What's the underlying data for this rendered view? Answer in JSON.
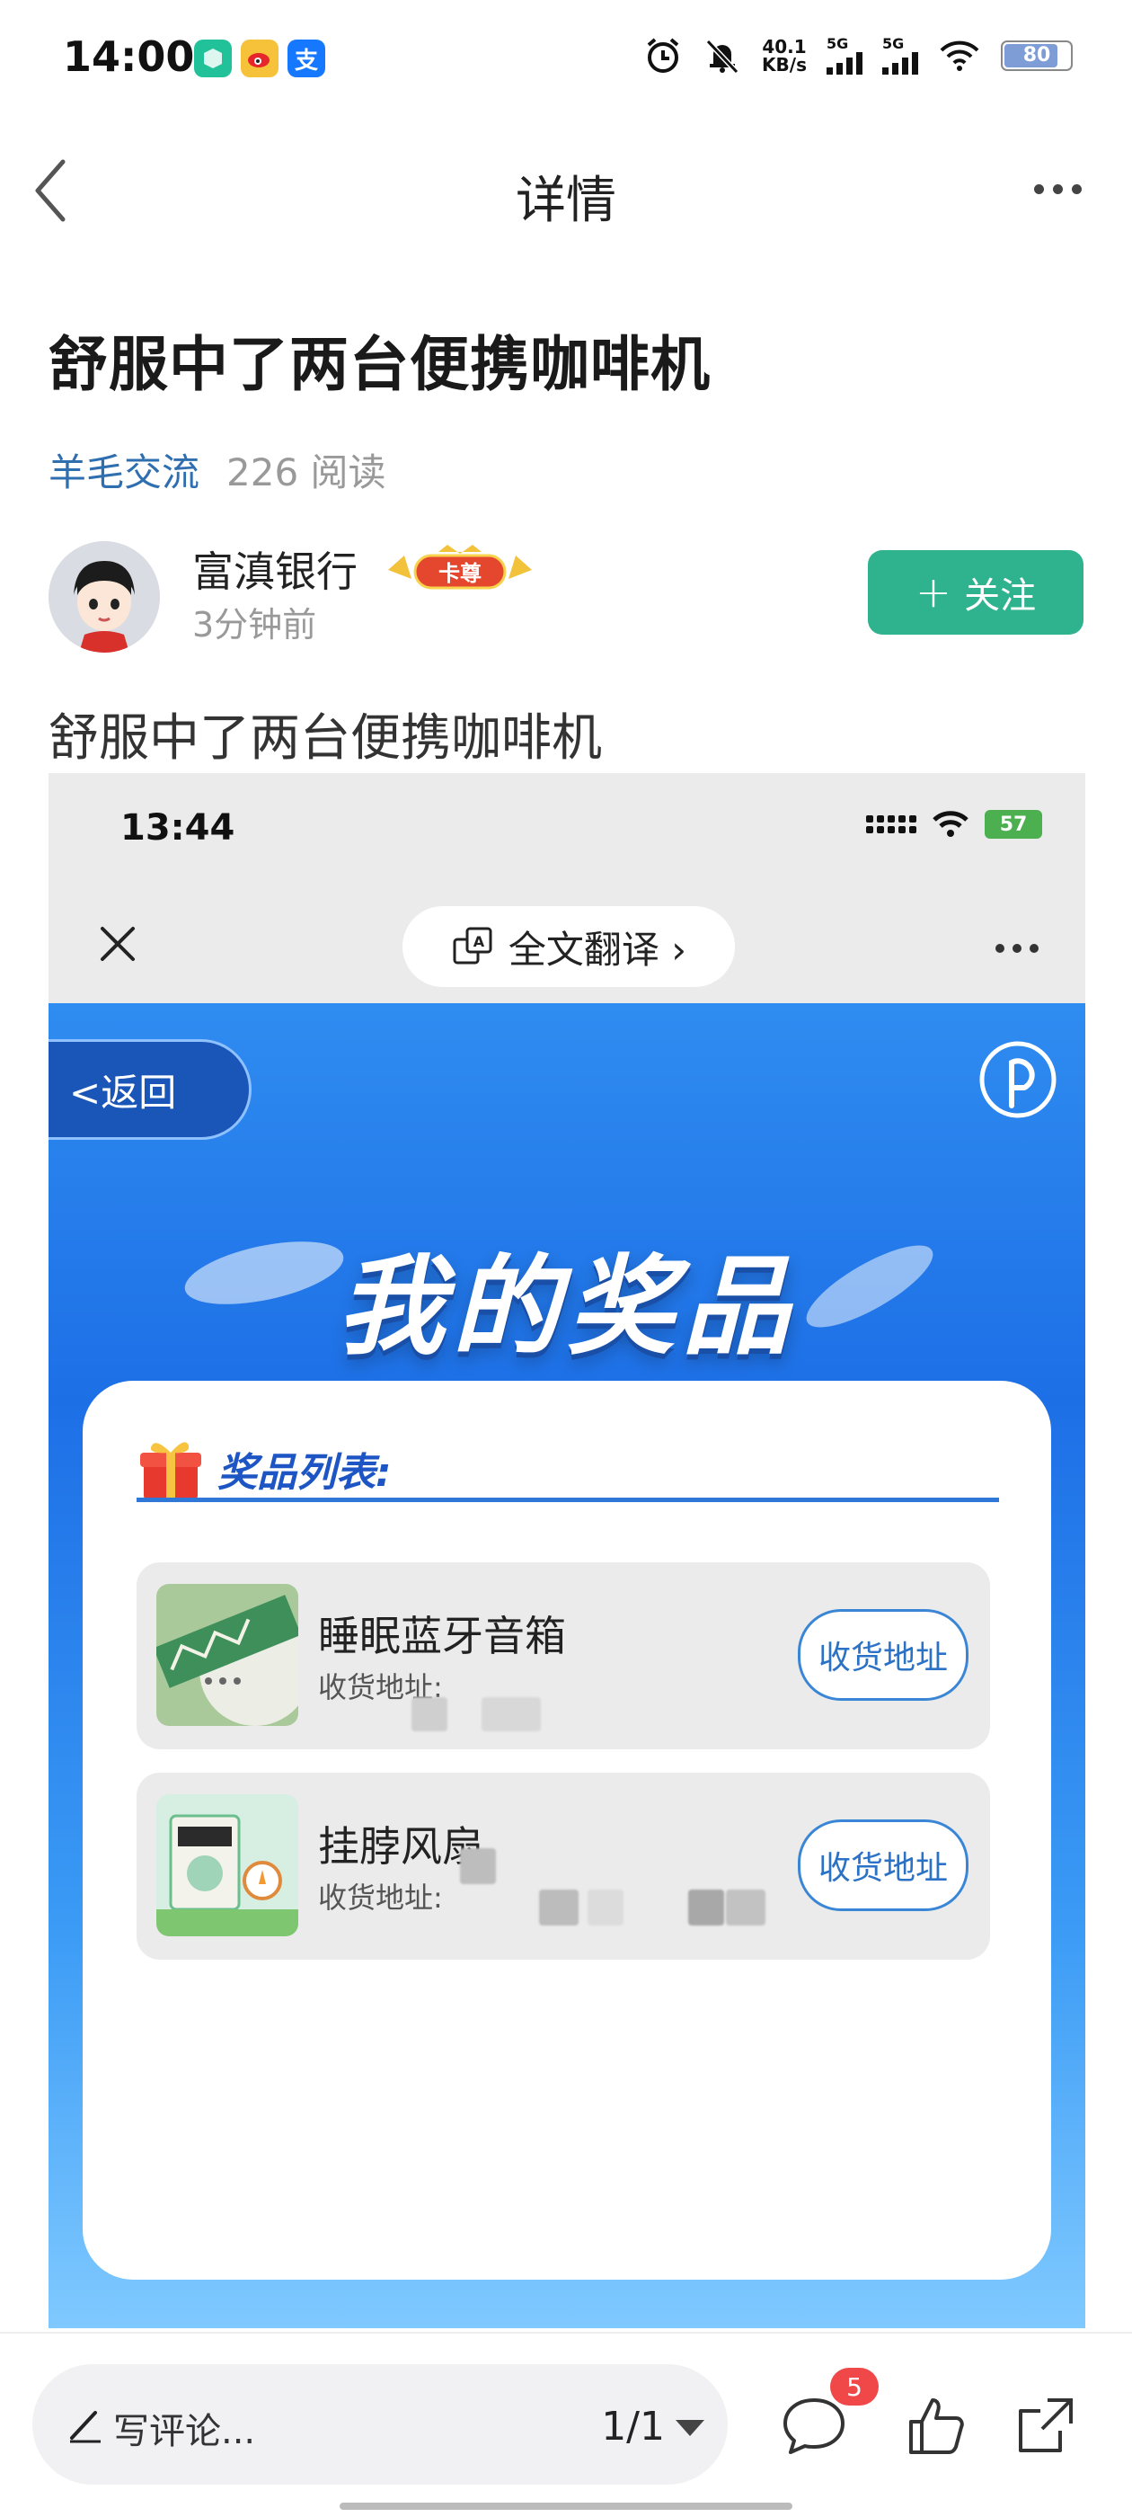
{
  "status_bar": {
    "time": "14:00",
    "net_speed_top": "40.1",
    "net_speed_bottom": "KB/s",
    "signal_1": "5G",
    "signal_2": "5G",
    "battery": "80",
    "app_icons": [
      "phone-manager-icon",
      "weibo-icon",
      "alipay-icon"
    ],
    "alipay_glyph": "支"
  },
  "header": {
    "title": "详情"
  },
  "article": {
    "title": "舒服中了两台便携咖啡机",
    "tag": "羊毛交流",
    "reads": "226 阅读",
    "author": "富滇银行",
    "badge": "卡尊",
    "time": "3分钟前",
    "follow_label": "关注",
    "body": "舒服中了两台便携咖啡机"
  },
  "screenshot": {
    "time": "13:44",
    "battery": "57",
    "translate_label": "全文翻译 ›",
    "back_label": "<返回",
    "promo_title": "我的奖品",
    "list_title": "奖品列表:",
    "items": [
      {
        "name": "睡眠蓝牙音箱",
        "addr_label": "收货地址:",
        "button": "收货地址"
      },
      {
        "name": "挂脖风扇",
        "addr_label": "收货地址:",
        "button": "收货地址"
      }
    ]
  },
  "bottom_bar": {
    "comment_placeholder": "写评论...",
    "page_indicator": "1/1",
    "comment_count": "5"
  },
  "colors": {
    "accent_green": "#2fb38f",
    "link_blue": "#2f6fb0",
    "promo_blue": "#1d6fe6",
    "badge_red": "#f04848"
  }
}
